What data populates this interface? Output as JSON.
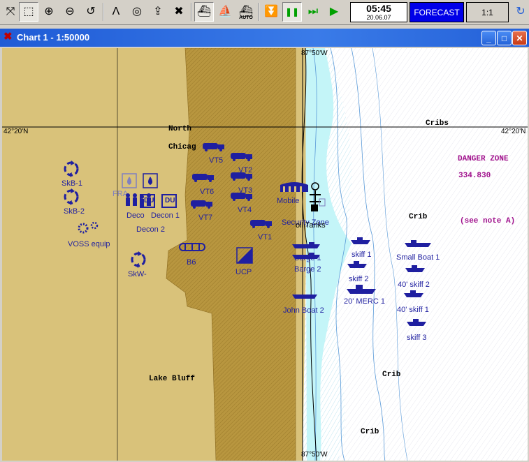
{
  "toolbar": {
    "buttons": [
      {
        "name": "move-icon",
        "glyph": "⤧"
      },
      {
        "name": "select-icon",
        "glyph": "⬚"
      },
      {
        "name": "zoom-in-icon",
        "glyph": "⊕"
      },
      {
        "name": "zoom-out-icon",
        "glyph": "⊖"
      },
      {
        "name": "undo-icon",
        "glyph": "↺"
      },
      {
        "name": "compass-icon",
        "glyph": "Λ"
      },
      {
        "name": "target-icon",
        "glyph": "◎"
      },
      {
        "name": "export-icon",
        "glyph": "⇪"
      },
      {
        "name": "delete-map-icon",
        "glyph": "✖"
      },
      {
        "name": "ship-icon",
        "glyph": "⛴"
      },
      {
        "name": "vessel-icon",
        "glyph": "⛵"
      },
      {
        "name": "auto-icon",
        "glyph": "⛴"
      },
      {
        "name": "download-icon",
        "glyph": "⏬"
      },
      {
        "name": "pause-icon",
        "glyph": "❚❚"
      },
      {
        "name": "fast-forward-icon",
        "glyph": "⏭"
      },
      {
        "name": "play-icon",
        "glyph": "▶"
      },
      {
        "name": "refresh-icon",
        "glyph": "↻"
      }
    ],
    "auto_label": "AUTO",
    "time": "05:45",
    "date": "20.06.07",
    "forecast_label": "FORECAST",
    "speed_label": "1:1"
  },
  "window": {
    "title": "Chart 1 - 1:50000",
    "minimize": "_",
    "maximize": "□",
    "close": "✕"
  },
  "map": {
    "colors": {
      "land": "#d9c27a",
      "urban": "#b8963f",
      "shallow": "#c4f5f8",
      "deep": "#ffffff",
      "asset": "#1f1fa0"
    },
    "coords": {
      "lon_top": "87°50'W",
      "lon_bottom": "87°50'W",
      "lat_left": "42°20'N",
      "lat_right": "42°20'N"
    },
    "places": {
      "north": "North",
      "chicago": "Chicag",
      "lake_bluff": "Lake Bluff",
      "cribs": "Cribs",
      "crib1": "Crib",
      "crib2": "Crib",
      "crib3": "Crib"
    },
    "danger_zone": {
      "title": "DANGER ZONE",
      "number": "334.830",
      "note": "(see note A)"
    },
    "assets": {
      "skb1": "SkB-1",
      "skb2": "SkB-2",
      "voss": "VOSS equip",
      "skw": "SkW-",
      "decon_a": "Deco",
      "decon1": "Decon 1",
      "decon2": "Decon 2",
      "du": "DU",
      "fra": "FRA",
      "b6": "B6",
      "ucp": "UCP",
      "vt5": "VT5",
      "vt2": "VT2",
      "vt6": "VT6",
      "vt3": "VT3",
      "vt4": "VT4",
      "vt7": "VT7",
      "vt1": "VT1",
      "mobile": "Mobile",
      "security_zone": "Security Zone",
      "oil_tanks": "oil Tanks",
      "barge1": "Barge 1",
      "barge2": "Barge 2",
      "john_boat2": "John Boat 2",
      "skiff1": "skiff 1",
      "skiff2": "skiff 2",
      "merc": "20' MERC 1",
      "small_boat": "Small Boat 1",
      "skiff40_2": "40' skiff 2",
      "skiff40_1": "40' skiff 1",
      "skiff3": "skiff 3"
    }
  }
}
